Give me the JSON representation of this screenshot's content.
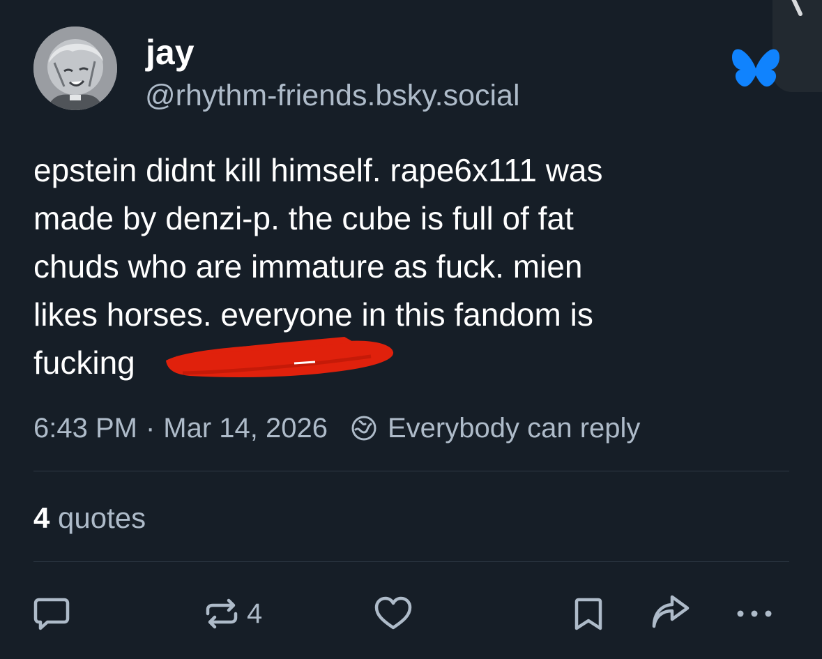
{
  "author": {
    "display_name": "jay",
    "handle": "@rhythm-friends.bsky.social"
  },
  "post": {
    "lines": [
      "epstein didnt kill himself. rape6x111 was",
      "made by denzi-p. the cube is full of fat",
      "chuds who are immature as fuck. mien",
      "likes horses. everyone in this fandom is",
      "fucking"
    ]
  },
  "meta": {
    "time": "6:43 PM",
    "separator": "·",
    "date": "Mar 14, 2026",
    "reply_setting": "Everybody can reply"
  },
  "stats": {
    "quotes_count": "4",
    "quotes_label": "quotes"
  },
  "actions": {
    "repost_count": "4"
  },
  "icons": {
    "app_logo": "butterfly-icon",
    "reply": "reply-icon",
    "repost": "repost-icon",
    "like": "heart-icon",
    "bookmark": "bookmark-icon",
    "share": "share-icon",
    "more": "more-icon",
    "audience": "globe-icon"
  },
  "colors": {
    "background": "#161e27",
    "text": "#ffffff",
    "muted": "#aebbc9",
    "brand": "#1083fe",
    "redaction": "#e0210c"
  }
}
